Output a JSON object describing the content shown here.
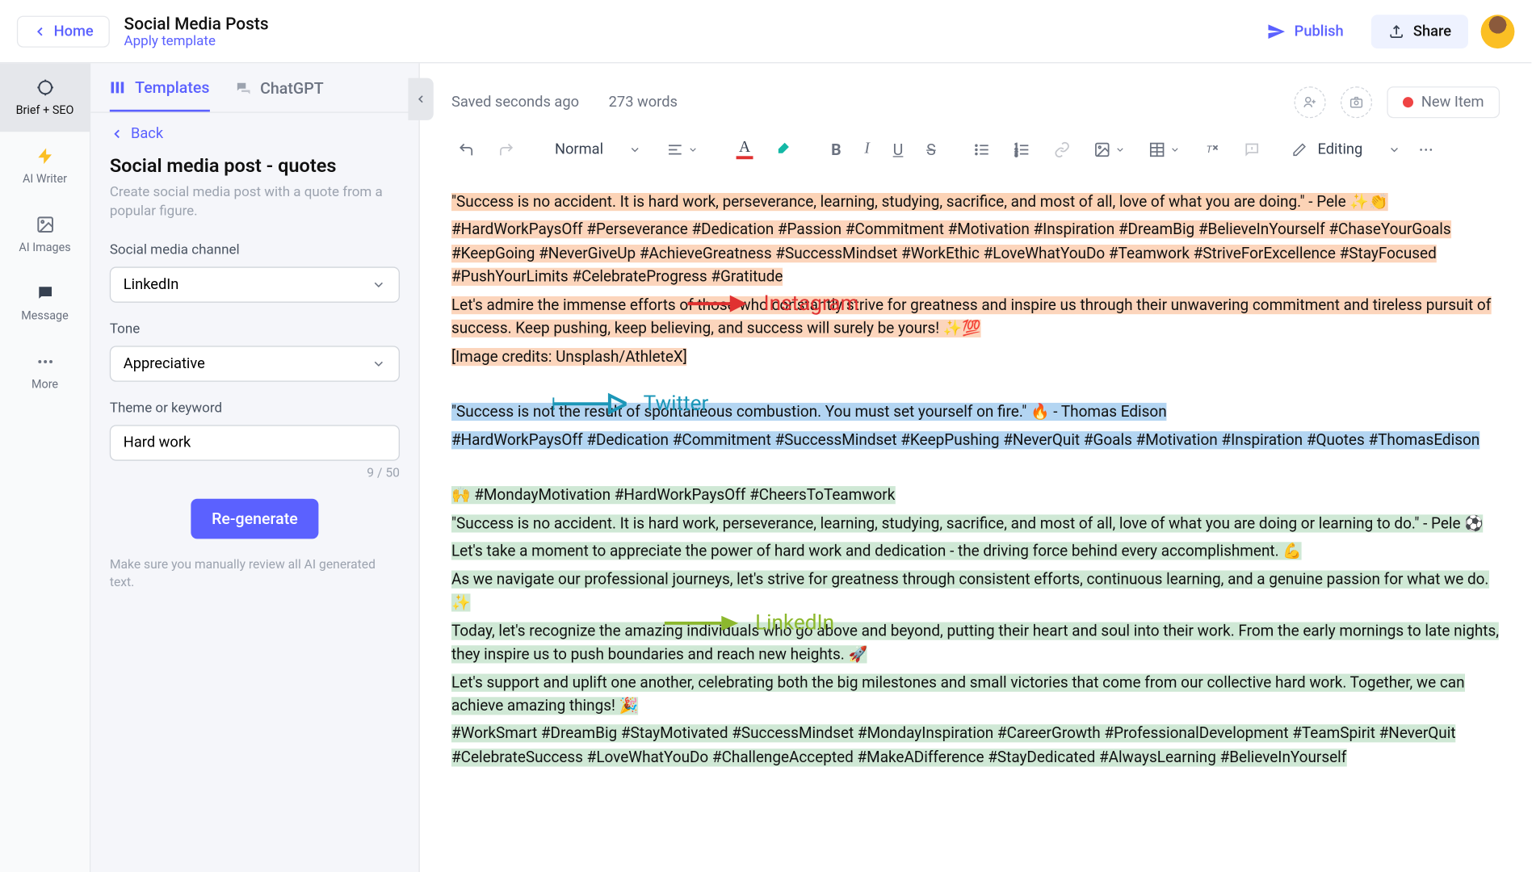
{
  "top": {
    "home": "Home",
    "title": "Social Media Posts",
    "apply_template": "Apply template",
    "publish": "Publish",
    "share": "Share"
  },
  "rail": {
    "brief": "Brief + SEO",
    "writer": "AI Writer",
    "images": "AI Images",
    "message": "Message",
    "more": "More"
  },
  "panel": {
    "tab_templates": "Templates",
    "tab_chatgpt": "ChatGPT",
    "back": "Back",
    "template_title": "Social media post - quotes",
    "template_desc": "Create social media post with a quote from a popular figure.",
    "channel_label": "Social media channel",
    "channel_value": "LinkedIn",
    "tone_label": "Tone",
    "tone_value": "Appreciative",
    "keyword_label": "Theme or keyword",
    "keyword_value": "Hard work",
    "char_count": "9 / 50",
    "regenerate": "Re-generate",
    "help_text": "Make sure you manually review all AI generated text."
  },
  "editor": {
    "saved": "Saved seconds ago",
    "words": "273 words",
    "status_label": "New Item",
    "style": "Normal",
    "mode": "Editing"
  },
  "annotations": {
    "instagram": "Instagram",
    "twitter": "Twitter",
    "linkedin": "LinkedIn"
  },
  "content": {
    "ig_quote": "\"Success is no accident. It is hard work, perseverance, learning, studying, sacrifice, and most of all, love of what you are doing.\" - Pele ✨👏",
    "ig_hashtags": "#HardWorkPaysOff #Perseverance #Dedication #Passion #Commitment #Motivation #Inspiration #DreamBig #BelieveInYourself #ChaseYourGoals #KeepGoing #NeverGiveUp #AchieveGreatness #SuccessMindset #WorkEthic #LoveWhatYouDo #Teamwork #StriveForExcellence #StayFocused #PushYourLimits #CelebrateProgress #Gratitude",
    "ig_body": "Let's admire the immense efforts of those who constantly strive for greatness and inspire us through their unwavering commitment and tireless pursuit of success. Keep pushing, keep believing, and success will surely be yours! ✨💯",
    "ig_credits": "[Image credits: Unsplash/AthleteX]",
    "tw_quote": "\"Success is not the result of spontaneous combustion. You must set yourself on fire.\" 🔥 - Thomas Edison",
    "tw_hashtags": "#HardWorkPaysOff #Dedication #Commitment #SuccessMindset #KeepPushing #NeverQuit #Goals #Motivation #Inspiration #Quotes #ThomasEdison",
    "li_header": "🙌 #MondayMotivation #HardWorkPaysOff #CheersToTeamwork",
    "li_quote": "\"Success is no accident. It is hard work, perseverance, learning, studying, sacrifice, and most of all, love of what you are doing or learning to do.\" - Pele ⚽",
    "li_p1": "Let's take a moment to appreciate the power of hard work and dedication - the driving force behind every accomplishment. 💪",
    "li_p2": "As we navigate our professional journeys, let's strive for greatness through consistent efforts, continuous learning, and a genuine passion for what we do. ✨",
    "li_p3": "Today, let's recognize the amazing individuals who go above and beyond, putting their heart and soul into their work. From the early mornings to late nights, they inspire us to push boundaries and reach new heights. 🚀",
    "li_p4": "Let's support and uplift one another, celebrating both the big milestones and small victories that come from our collective hard work. Together, we can achieve amazing things! 🎉",
    "li_hashtags": "#WorkSmart #DreamBig #StayMotivated #SuccessMindset #MondayInspiration #CareerGrowth #ProfessionalDevelopment #TeamSpirit #NeverQuit #CelebrateSuccess #LoveWhatYouDo #ChallengeAccepted #MakeADifference #StayDedicated #AlwaysLearning #BelieveInYourself"
  }
}
